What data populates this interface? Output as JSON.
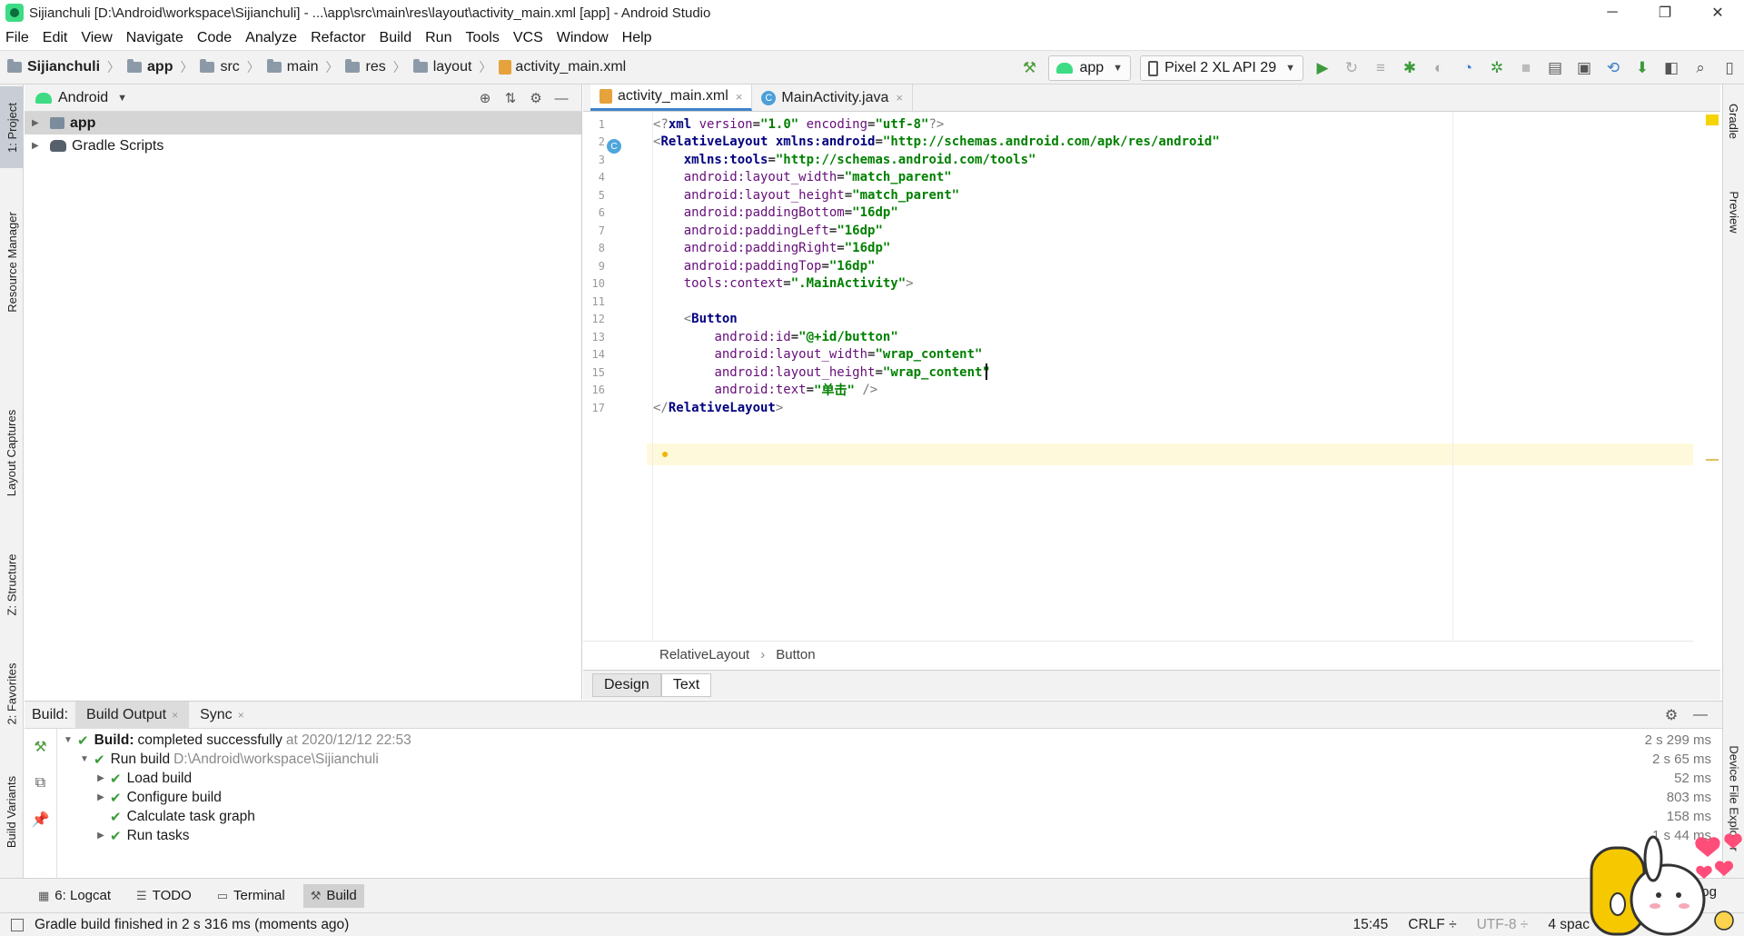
{
  "window": {
    "title": "Sijianchuli [D:\\Android\\workspace\\Sijianchuli] - ...\\app\\src\\main\\res\\layout\\activity_main.xml [app] - Android Studio",
    "minimize_label": "─",
    "maximize_label": "❐",
    "close_label": "✕"
  },
  "menu": [
    "File",
    "Edit",
    "View",
    "Navigate",
    "Code",
    "Analyze",
    "Refactor",
    "Build",
    "Run",
    "Tools",
    "VCS",
    "Window",
    "Help"
  ],
  "navbar": {
    "crumbs": [
      "Sijianchuli",
      "app",
      "src",
      "main",
      "res",
      "layout",
      "activity_main.xml"
    ],
    "run_config": "app",
    "device": "Pixel 2 XL API 29"
  },
  "left_stripe": [
    "1: Project",
    "Resource Manager",
    "Layout Captures",
    "Z: Structure",
    "2: Favorites",
    "Build Variants"
  ],
  "right_stripe": [
    "Gradle",
    "Preview",
    "Device File Explorer"
  ],
  "project_panel": {
    "view_selector": "Android",
    "items": [
      {
        "label": "app"
      },
      {
        "label": "Gradle Scripts"
      }
    ]
  },
  "editor": {
    "tabs": [
      {
        "label": "activity_main.xml",
        "close": "×"
      },
      {
        "label": "MainActivity.java",
        "close": "×"
      }
    ],
    "line_numbers": [
      "1",
      "2",
      "3",
      "4",
      "5",
      "6",
      "7",
      "8",
      "9",
      "10",
      "11",
      "12",
      "13",
      "14",
      "15",
      "16",
      "17"
    ],
    "breadcrumb": [
      "RelativeLayout",
      "Button"
    ],
    "breadcrumb_sep": "›",
    "view_tabs": [
      "Design",
      "Text"
    ]
  },
  "code_lines": [
    [
      {
        "c": "lt",
        "t": "<?"
      },
      {
        "c": "t",
        "t": "xml "
      },
      {
        "c": "a",
        "t": "version"
      },
      {
        "c": "p",
        "t": "="
      },
      {
        "c": "v",
        "t": "\"1.0\" "
      },
      {
        "c": "a",
        "t": "encoding"
      },
      {
        "c": "p",
        "t": "="
      },
      {
        "c": "v",
        "t": "\"utf-8\""
      },
      {
        "c": "lt",
        "t": "?>"
      }
    ],
    [
      {
        "c": "lt",
        "t": "<"
      },
      {
        "c": "t",
        "t": "RelativeLayout "
      },
      {
        "c": "t",
        "t": "xmlns:android"
      },
      {
        "c": "p",
        "t": "="
      },
      {
        "c": "v",
        "t": "\"http://schemas.android.com/apk/res/android\""
      }
    ],
    [
      {
        "c": "p",
        "t": "    "
      },
      {
        "c": "t",
        "t": "xmlns:tools"
      },
      {
        "c": "p",
        "t": "="
      },
      {
        "c": "v",
        "t": "\"http://schemas.android.com/tools\""
      }
    ],
    [
      {
        "c": "p",
        "t": "    "
      },
      {
        "c": "a",
        "t": "android:layout_width"
      },
      {
        "c": "p",
        "t": "="
      },
      {
        "c": "v",
        "t": "\"match_parent\""
      }
    ],
    [
      {
        "c": "p",
        "t": "    "
      },
      {
        "c": "a",
        "t": "android:layout_height"
      },
      {
        "c": "p",
        "t": "="
      },
      {
        "c": "v",
        "t": "\"match_parent\""
      }
    ],
    [
      {
        "c": "p",
        "t": "    "
      },
      {
        "c": "a",
        "t": "android:paddingBottom"
      },
      {
        "c": "p",
        "t": "="
      },
      {
        "c": "v",
        "t": "\"16dp\""
      }
    ],
    [
      {
        "c": "p",
        "t": "    "
      },
      {
        "c": "a",
        "t": "android:paddingLeft"
      },
      {
        "c": "p",
        "t": "="
      },
      {
        "c": "v",
        "t": "\"16dp\""
      }
    ],
    [
      {
        "c": "p",
        "t": "    "
      },
      {
        "c": "a",
        "t": "android:paddingRight"
      },
      {
        "c": "p",
        "t": "="
      },
      {
        "c": "v",
        "t": "\"16dp\""
      }
    ],
    [
      {
        "c": "p",
        "t": "    "
      },
      {
        "c": "a",
        "t": "android:paddingTop"
      },
      {
        "c": "p",
        "t": "="
      },
      {
        "c": "v",
        "t": "\"16dp\""
      }
    ],
    [
      {
        "c": "p",
        "t": "    "
      },
      {
        "c": "a",
        "t": "tools:context"
      },
      {
        "c": "p",
        "t": "="
      },
      {
        "c": "v",
        "t": "\".MainActivity\""
      },
      {
        "c": "lt",
        "t": ">"
      }
    ],
    [],
    [
      {
        "c": "p",
        "t": "    "
      },
      {
        "c": "lt",
        "t": "<"
      },
      {
        "c": "t",
        "t": "Button"
      }
    ],
    [
      {
        "c": "p",
        "t": "        "
      },
      {
        "c": "a",
        "t": "android:id"
      },
      {
        "c": "p",
        "t": "="
      },
      {
        "c": "v",
        "t": "\"@+id/button\""
      }
    ],
    [
      {
        "c": "p",
        "t": "        "
      },
      {
        "c": "a",
        "t": "android:layout_width"
      },
      {
        "c": "p",
        "t": "="
      },
      {
        "c": "v",
        "t": "\"wrap_content\""
      }
    ],
    [
      {
        "c": "p",
        "t": "        "
      },
      {
        "c": "a",
        "t": "android:layout_height"
      },
      {
        "c": "p",
        "t": "="
      },
      {
        "c": "v",
        "t": "\"wrap_content\""
      }
    ],
    [
      {
        "c": "p",
        "t": "        "
      },
      {
        "c": "a",
        "t": "android:text"
      },
      {
        "c": "p",
        "t": "="
      },
      {
        "c": "v",
        "t": "\"单击\" "
      },
      {
        "c": "lt",
        "t": "/>"
      }
    ],
    [
      {
        "c": "lt",
        "t": "</"
      },
      {
        "c": "t",
        "t": "RelativeLayout"
      },
      {
        "c": "lt",
        "t": ">"
      }
    ]
  ],
  "build": {
    "label": "Build:",
    "tabs": [
      {
        "label": "Build Output"
      },
      {
        "label": "Sync"
      }
    ],
    "rows": [
      {
        "bold": "Build:",
        "text": "completed successfully",
        "muted": "at 2020/12/12 22:53",
        "duration": "2 s 299 ms"
      },
      {
        "bold": "",
        "text": "Run build",
        "muted": "D:\\Android\\workspace\\Sijianchuli",
        "duration": "2 s 65 ms"
      },
      {
        "bold": "",
        "text": "Load build",
        "muted": "",
        "duration": "52 ms"
      },
      {
        "bold": "",
        "text": "Configure build",
        "muted": "",
        "duration": "803 ms"
      },
      {
        "bold": "",
        "text": "Calculate task graph",
        "muted": "",
        "duration": "158 ms"
      },
      {
        "bold": "",
        "text": "Run tasks",
        "muted": "",
        "duration": "1 s 44 ms"
      }
    ]
  },
  "toolwindows": [
    {
      "icon": "6",
      "label": "6: Logcat"
    },
    {
      "icon": "☰",
      "label": "TODO"
    },
    {
      "icon": "▭",
      "label": "Terminal"
    },
    {
      "icon": "⚒",
      "label": "Build"
    }
  ],
  "toolwindows_right": "Log",
  "status": {
    "message": "Gradle build finished in 2 s 316 ms (moments ago)",
    "position": "15:45",
    "line_sep": "CRLF ÷",
    "encoding": "UTF-8 ÷",
    "indent": "4 spac"
  },
  "colors": {
    "accent": "#4083c9",
    "success": "#3c9b3c",
    "current_line": "#fff9db"
  }
}
